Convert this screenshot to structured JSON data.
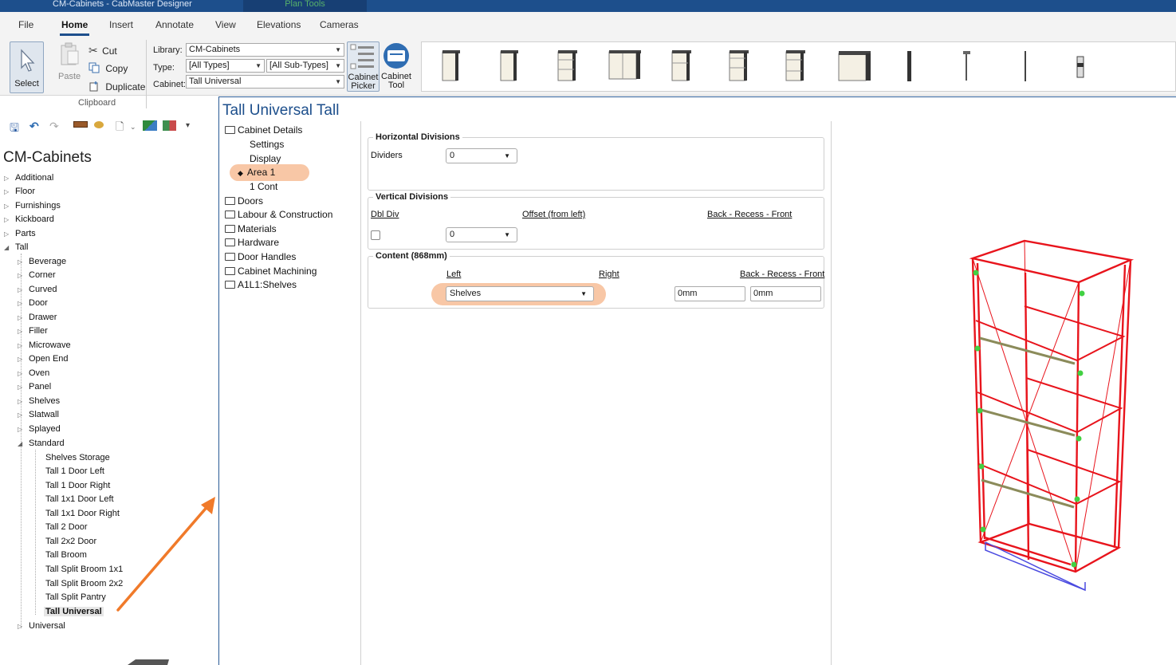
{
  "window": {
    "title": "CM-Cabinets - CabMaster Designer",
    "context_tab": "Plan Tools"
  },
  "ribbon": {
    "tabs": [
      "File",
      "Home",
      "Insert",
      "Annotate",
      "View",
      "Elevations",
      "Cameras"
    ],
    "active_tab": "Home",
    "select_label": "Select",
    "paste_label": "Paste",
    "cut_label": "Cut",
    "copy_label": "Copy",
    "duplicate_label": "Duplicate",
    "clipboard_group": "Clipboard",
    "library_label": "Library:",
    "library_value": "CM-Cabinets",
    "type_label": "Type:",
    "type_value": "[All Types]",
    "subtype_value": "[All Sub-Types]",
    "cabinet_label": "Cabinet:",
    "cabinet_value": "Tall Universal",
    "cabinet_picker_line1": "Cabinet",
    "cabinet_picker_line2": "Picker",
    "cabinet_tool_line1": "Cabinet",
    "cabinet_tool_line2": "Tool"
  },
  "library": {
    "title": "CM-Cabinets",
    "top_items": [
      "Additional",
      "Floor",
      "Furnishings",
      "Kickboard",
      "Parts",
      "Tall"
    ],
    "tall_children": [
      "Beverage",
      "Corner",
      "Curved",
      "Door",
      "Drawer",
      "Filler",
      "Microwave",
      "Open End",
      "Oven",
      "Panel",
      "Shelves",
      "Slatwall",
      "Splayed",
      "Standard"
    ],
    "standard_children": [
      "Shelves Storage",
      "Tall 1 Door Left",
      "Tall 1 Door Right",
      "Tall 1x1 Door Left",
      "Tall 1x1 Door Right",
      "Tall 2 Door",
      "Tall 2x2 Door",
      "Tall Broom",
      "Tall Split Broom 1x1",
      "Tall Split Broom 2x2",
      "Tall Split Pantry",
      "Tall Universal"
    ],
    "after_standard": "Universal",
    "selected": "Tall Universal"
  },
  "editor": {
    "title": "Tall Universal Tall",
    "nav": {
      "cabinet_details": "Cabinet Details",
      "settings": "Settings",
      "display": "Display",
      "area1": "Area 1",
      "cont1": "1 Cont",
      "folders": [
        "Doors",
        "Labour & Construction",
        "Materials",
        "Hardware",
        "Door Handles",
        "Cabinet Machining",
        "A1L1:Shelves"
      ]
    },
    "horizontal": {
      "legend": "Horizontal Divisions",
      "dividers_label": "Dividers",
      "dividers_value": "0"
    },
    "vertical": {
      "legend": "Vertical Divisions",
      "dbl_div": "Dbl Div",
      "offset": "Offset (from left)",
      "back_recess_front": "Back - Recess - Front",
      "value": "0"
    },
    "content": {
      "legend": "Content (868mm)",
      "left": "Left",
      "right": "Right",
      "back_recess_front": "Back - Recess - Front",
      "shelves_value": "Shelves",
      "recess_value": "0mm",
      "front_value": "0mm"
    }
  },
  "colors": {
    "titlebar": "#1d4f8c",
    "highlight": "#f8c7a6",
    "annotation_arrow": "#f07a2a",
    "cabinet_wire": "#e8141c"
  }
}
